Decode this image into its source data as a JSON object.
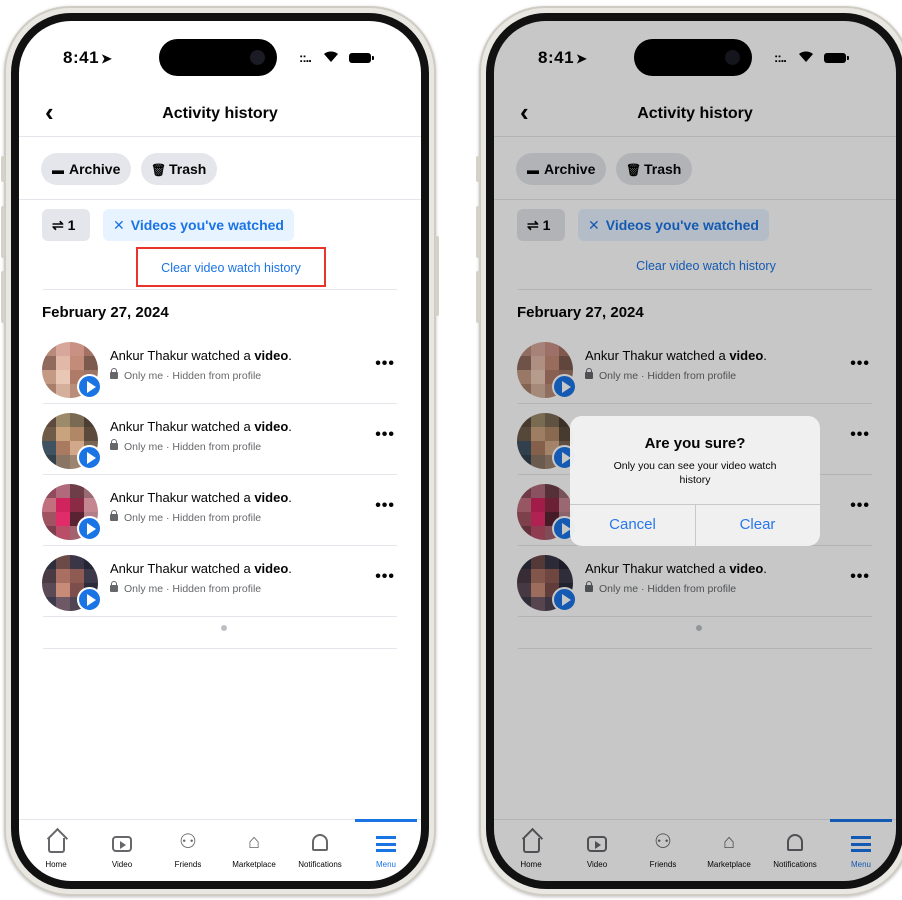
{
  "status": {
    "time": "8:41",
    "signal": "::..",
    "time_arrow": "➤"
  },
  "header": {
    "back_label": "‹",
    "title": "Activity history"
  },
  "chips": {
    "archive": "Archive",
    "trash": "Trash"
  },
  "filters": {
    "count": "1",
    "active_filter": "Videos you've watched",
    "clear_label": "Clear video watch history"
  },
  "date_heading": "February 27, 2024",
  "items": [
    {
      "user": "Ankur Thakur",
      "action": "watched a",
      "object": "video",
      "privacy": "Only me · Hidden from profile"
    },
    {
      "user": "Ankur Thakur",
      "action": "watched a",
      "object": "video",
      "privacy": "Only me · Hidden from profile"
    },
    {
      "user": "Ankur Thakur",
      "action": "watched a",
      "object": "video",
      "privacy": "Only me · Hidden from profile"
    },
    {
      "user": "Ankur Thakur",
      "action": "watched a",
      "object": "video",
      "privacy": "Only me · Hidden from profile"
    }
  ],
  "more_label": "•••",
  "tabs": [
    {
      "label": "Home",
      "icon": "home-icon"
    },
    {
      "label": "Video",
      "icon": "video-icon"
    },
    {
      "label": "Friends",
      "icon": "friends-icon"
    },
    {
      "label": "Marketplace",
      "icon": "marketplace-icon"
    },
    {
      "label": "Notifications",
      "icon": "bell-icon"
    },
    {
      "label": "Menu",
      "icon": "menu-icon",
      "active": true
    }
  ],
  "dialog": {
    "title": "Are you sure?",
    "message": "Only you can see your video watch history",
    "cancel": "Cancel",
    "confirm": "Clear"
  },
  "colors": {
    "accent": "#1b74e4",
    "highlight_box": "#e8342b",
    "chip_bg": "#e4e6eb"
  }
}
